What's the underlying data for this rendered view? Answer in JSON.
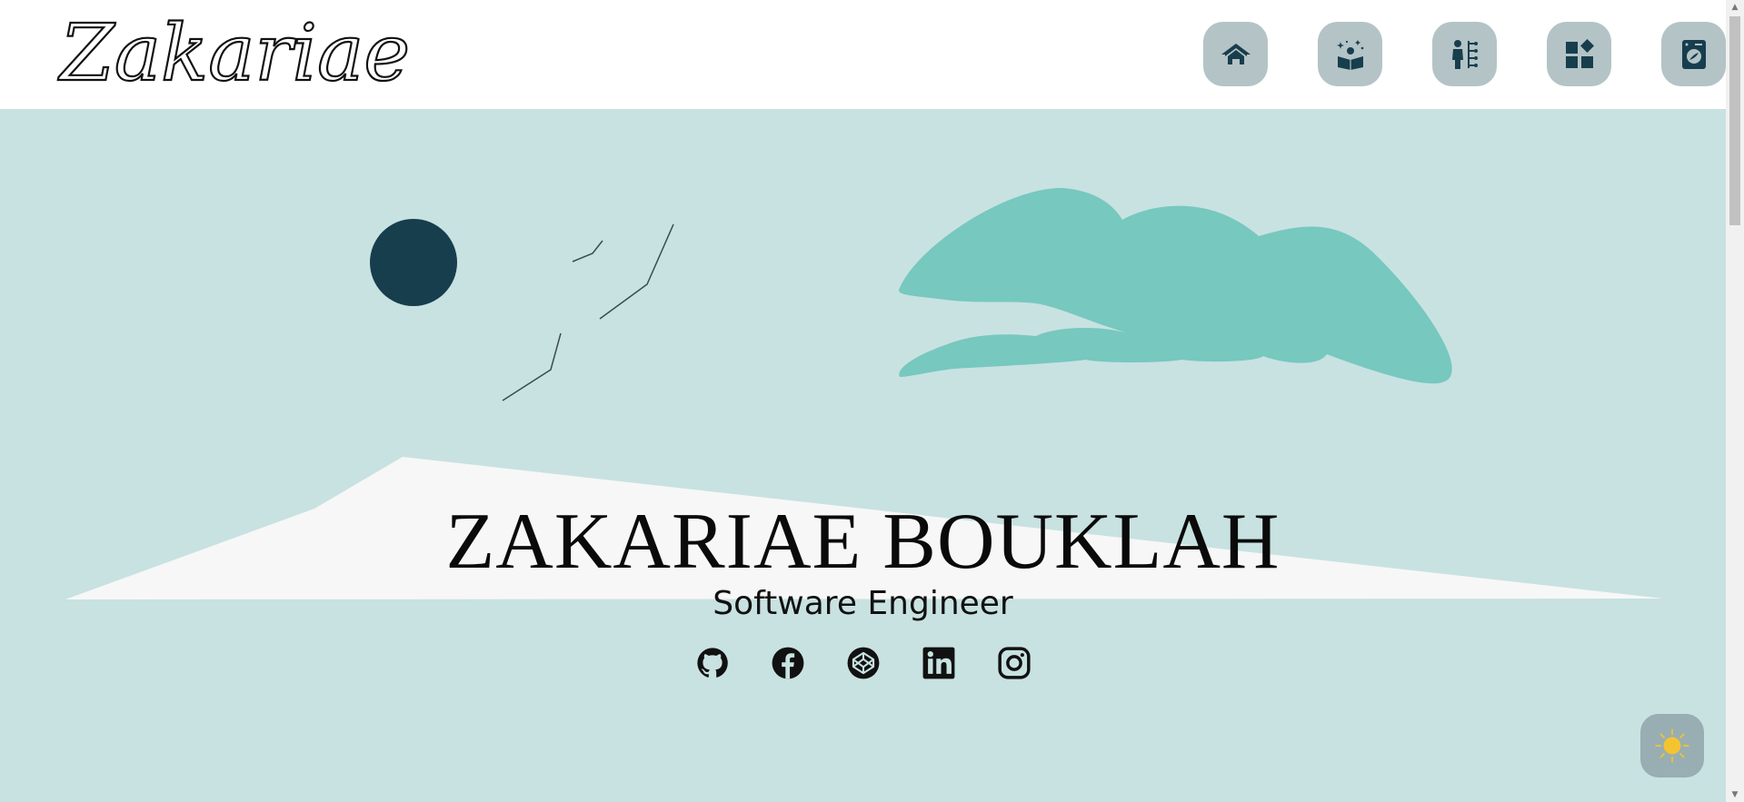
{
  "logo": {
    "text": "Zakariae"
  },
  "nav": [
    {
      "name": "home",
      "icon": "house-icon"
    },
    {
      "name": "about",
      "icon": "reading-book-icon"
    },
    {
      "name": "skills",
      "icon": "person-tree-icon"
    },
    {
      "name": "projects",
      "icon": "widgets-icon"
    },
    {
      "name": "blog",
      "icon": "washing-machine-icon"
    }
  ],
  "hero": {
    "name": "ZAKARIAE BOUKLAH",
    "role": "Software Engineer"
  },
  "social": [
    {
      "name": "github",
      "icon": "github-icon"
    },
    {
      "name": "facebook",
      "icon": "facebook-icon"
    },
    {
      "name": "codepen",
      "icon": "codepen-icon"
    },
    {
      "name": "linkedin",
      "icon": "linkedin-icon"
    },
    {
      "name": "instagram",
      "icon": "instagram-icon"
    }
  ],
  "theme_toggle": {
    "icon": "sun-icon"
  },
  "colors": {
    "hero_bg": "#c8e2e1",
    "moon": "#173e4d",
    "cloud": "#77c8bf",
    "mountain": "#f7f7f7",
    "nav_button": "#b4c3c6",
    "icon": "#173e4d",
    "sun": "#f4c430"
  }
}
